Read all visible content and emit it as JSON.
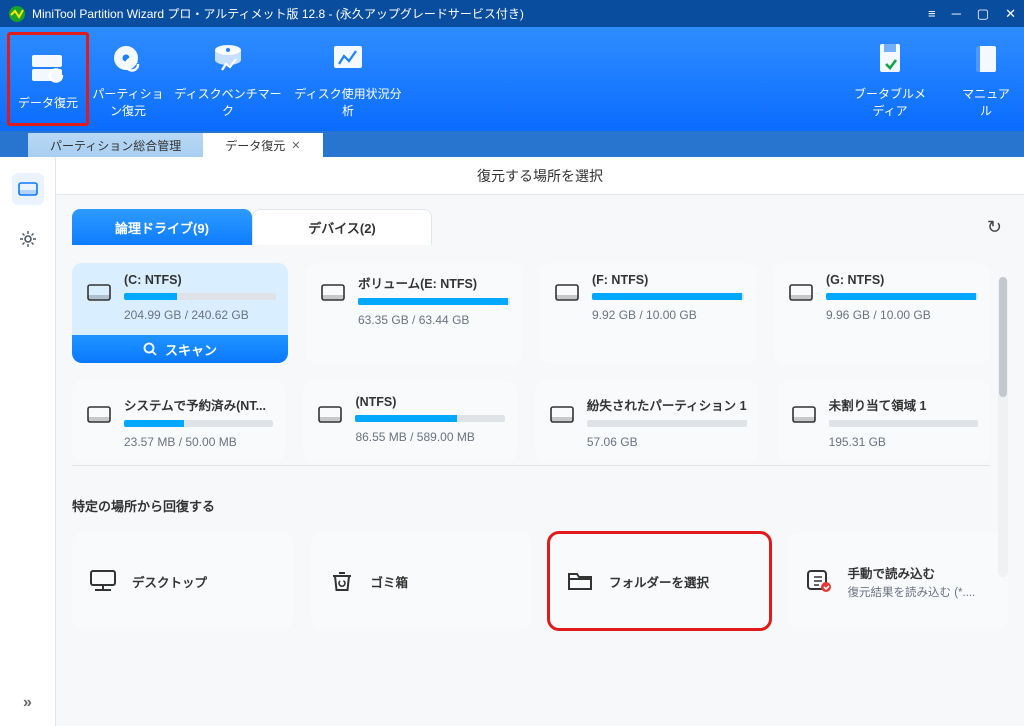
{
  "title": "MiniTool Partition Wizard プロ・アルティメット版 12.8 - (永久アップグレードサービス付き)",
  "toolbar": {
    "data_recovery": "データ復元",
    "partition_recovery": "パーティション復元",
    "disk_benchmark": "ディスクベンチマーク",
    "space_analyzer": "ディスク使用状況分析",
    "bootable_media": "ブータブルメディア",
    "manual": "マニュアル"
  },
  "tabs": [
    {
      "label": "パーティション総合管理",
      "active": false
    },
    {
      "label": "データ復元",
      "active": true,
      "closable": true
    }
  ],
  "main_title": "復元する場所を選択",
  "drive_tabs": {
    "logical": {
      "label": "論理ドライブ(9)",
      "active": true
    },
    "device": {
      "label": "デバイス(2)",
      "active": false
    }
  },
  "drives_row1": [
    {
      "name": "(C: NTFS)",
      "size": "204.99 GB / 240.62 GB",
      "fill": 35,
      "selected": true
    },
    {
      "name": "ボリューム(E: NTFS)",
      "size": "63.35 GB / 63.44 GB",
      "fill": 99
    },
    {
      "name": "(F: NTFS)",
      "size": "9.92 GB / 10.00 GB",
      "fill": 99
    },
    {
      "name": "(G: NTFS)",
      "size": "9.96 GB / 10.00 GB",
      "fill": 99
    }
  ],
  "drives_row2": [
    {
      "name": "システムで予約済み(NT...",
      "size": "23.57 MB / 50.00 MB",
      "fill": 40
    },
    {
      "name": "(NTFS)",
      "size": "86.55 MB / 589.00 MB",
      "fill": 68
    },
    {
      "name": "紛失されたパーティション 1",
      "size": "57.06 GB",
      "fill": 0,
      "empty": true
    },
    {
      "name": "未割り当て領域 1",
      "size": "195.31 GB",
      "fill": 0,
      "empty": true
    }
  ],
  "scan_button": "スキャン",
  "specific_location_title": "特定の場所から回復する",
  "locations": [
    {
      "id": "desktop",
      "name": "デスクトップ"
    },
    {
      "id": "recycle",
      "name": "ゴミ箱"
    },
    {
      "id": "folder",
      "name": "フォルダーを選択",
      "highlight": true
    },
    {
      "id": "manual",
      "name": "手動で読み込む",
      "sub": "復元結果を読み込む (*...."
    }
  ]
}
